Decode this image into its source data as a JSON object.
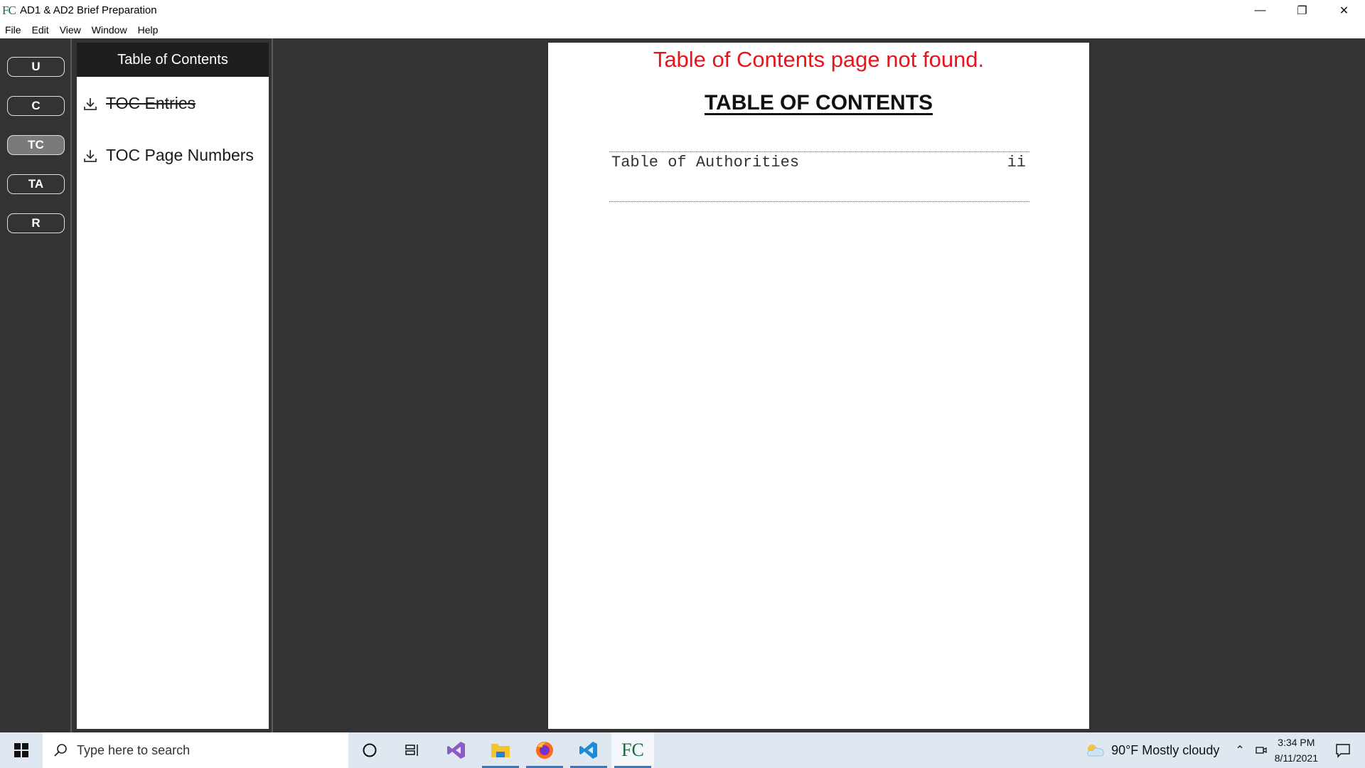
{
  "window": {
    "logo": "FC",
    "title": "AD1 & AD2 Brief Preparation",
    "controls": {
      "minimize": "—",
      "restore": "❐",
      "close": "✕"
    }
  },
  "menu": [
    "File",
    "Edit",
    "View",
    "Window",
    "Help"
  ],
  "rail": {
    "buttons": [
      {
        "label": "U",
        "active": false
      },
      {
        "label": "C",
        "active": false
      },
      {
        "label": "TC",
        "active": true
      },
      {
        "label": "TA",
        "active": false
      },
      {
        "label": "R",
        "active": false
      }
    ]
  },
  "side_panel": {
    "header": "Table of Contents",
    "items": [
      {
        "label": "TOC Entries",
        "strikethrough": true,
        "icon": "download-icon"
      },
      {
        "label": "TOC Page Numbers",
        "strikethrough": false,
        "icon": "download-icon"
      }
    ]
  },
  "document": {
    "error_message": "Table of Contents page not found.",
    "heading": "TABLE OF CONTENTS",
    "entries": [
      {
        "text": "Table of Authorities",
        "page": "ii"
      }
    ],
    "colors": {
      "error": "#e8141c",
      "border": "#e02020"
    }
  },
  "taskbar": {
    "search_placeholder": "Type here to search",
    "apps": [
      "cortana-icon",
      "task-view-icon",
      "visual-studio-icon",
      "file-explorer-icon",
      "firefox-icon",
      "vscode-icon",
      "fc-app-icon"
    ],
    "weather": "90°F  Mostly cloudy",
    "time": "3:34 PM",
    "date": "8/11/2021"
  }
}
